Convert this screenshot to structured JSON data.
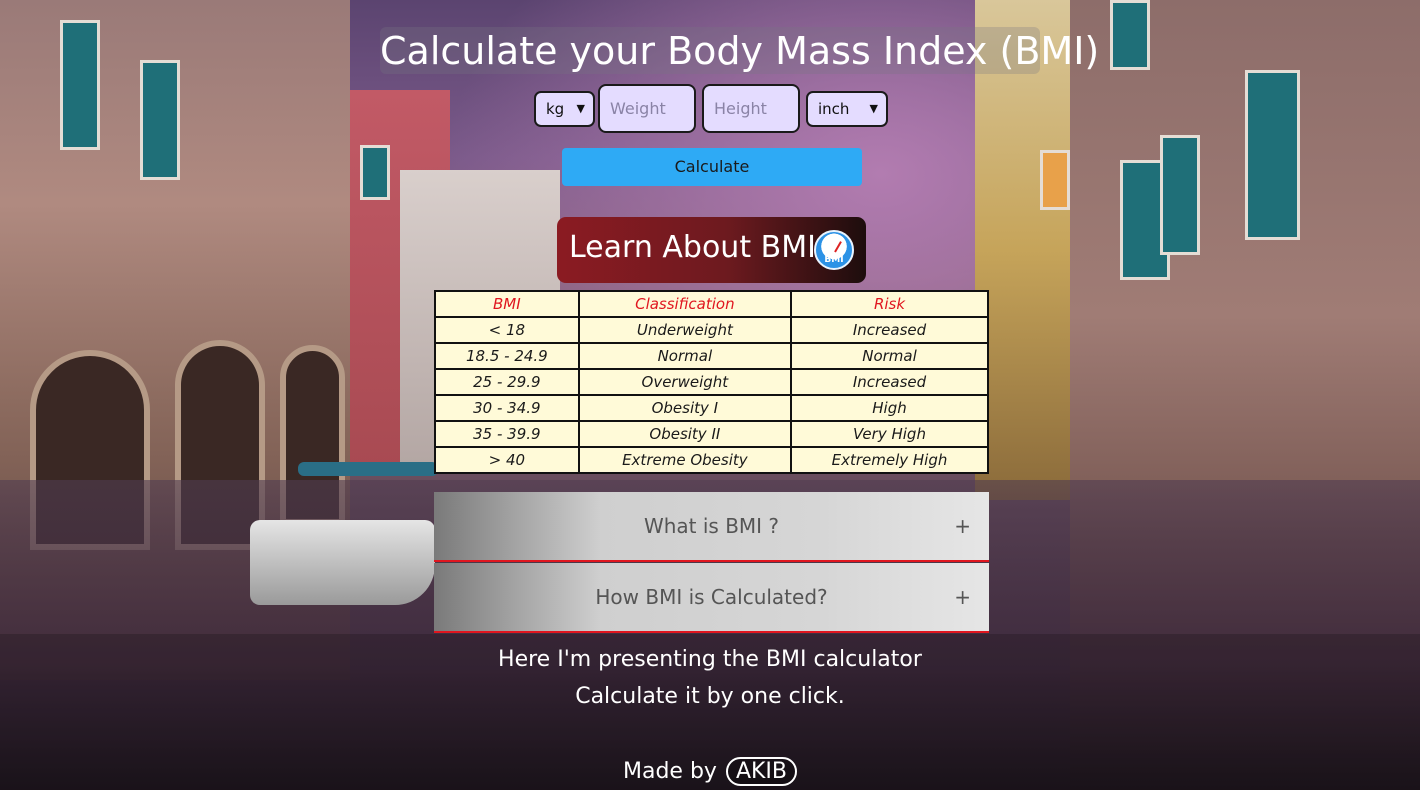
{
  "header": {
    "title": "Calculate your Body Mass Index (BMI)"
  },
  "form": {
    "weight_unit": "kg",
    "weight_placeholder": "Weight",
    "height_placeholder": "Height",
    "height_unit": "inch",
    "calculate_label": "Calculate"
  },
  "learn": {
    "label": "Learn About BMI",
    "icon_text": "BMI"
  },
  "table": {
    "headers": [
      "BMI",
      "Classification",
      "Risk"
    ],
    "rows": [
      [
        "< 18",
        "Underweight",
        "Increased"
      ],
      [
        "18.5 - 24.9",
        "Normal",
        "Normal"
      ],
      [
        "25 - 29.9",
        "Overweight",
        "Increased"
      ],
      [
        "30 - 34.9",
        "Obesity I",
        "High"
      ],
      [
        "35 - 39.9",
        "Obesity II",
        "Very High"
      ],
      [
        "> 40",
        "Extreme Obesity",
        "Extremely High"
      ]
    ]
  },
  "accordion": [
    {
      "label": "What is BMI ?",
      "toggle": "+"
    },
    {
      "label": "How BMI is Calculated?",
      "toggle": "+"
    }
  ],
  "footer": {
    "line1": "Here I'm presenting the BMI calculator",
    "line2": "Calculate it by one click.",
    "made_by": "Made by",
    "author": "AKIB"
  },
  "colors": {
    "accent": "#2eaaf5",
    "header_red": "#e0161f",
    "table_bg": "#fffad8",
    "input_bg": "#e4dcff"
  },
  "icons": {
    "learn": "bmi-gauge-icon",
    "select_arrow": "chevron-down-icon"
  }
}
